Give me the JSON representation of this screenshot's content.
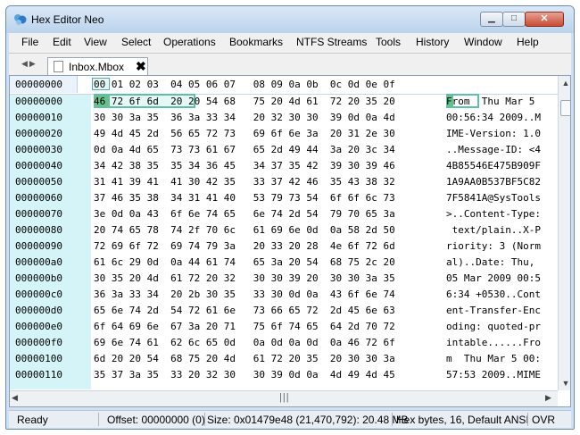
{
  "window": {
    "title": "Hex Editor Neo",
    "controls": {
      "minimize": "▁",
      "maximize": "□",
      "close": "✕"
    }
  },
  "menu": [
    "File",
    "Edit",
    "View",
    "Select",
    "Operations",
    "Bookmarks",
    "NTFS Streams",
    "Tools",
    "History",
    "Window",
    "Help"
  ],
  "tab": {
    "label": "Inbox.Mbox",
    "close": "✖"
  },
  "hex_header": {
    "offset_label": "00000000",
    "columns": "00 01 02 03  04 05 06 07   08 09 0a 0b  0c 0d 0e 0f"
  },
  "rows": [
    {
      "off": "00000000",
      "hex": "46 72 6f 6d  20 20 54 68   75 20 4d 61  72 20 35 20",
      "text": "From  Thu Mar 5 "
    },
    {
      "off": "00000010",
      "hex": "30 30 3a 35  36 3a 33 34   20 32 30 30  39 0d 0a 4d",
      "text": "00:56:34 2009..M"
    },
    {
      "off": "00000020",
      "hex": "49 4d 45 2d  56 65 72 73   69 6f 6e 3a  20 31 2e 30",
      "text": "IME-Version: 1.0"
    },
    {
      "off": "00000030",
      "hex": "0d 0a 4d 65  73 73 61 67   65 2d 49 44  3a 20 3c 34",
      "text": "..Message-ID: <4"
    },
    {
      "off": "00000040",
      "hex": "34 42 38 35  35 34 36 45   34 37 35 42  39 30 39 46",
      "text": "4B85546E475B909F"
    },
    {
      "off": "00000050",
      "hex": "31 41 39 41  41 30 42 35   33 37 42 46  35 43 38 32",
      "text": "1A9AA0B537BF5C82"
    },
    {
      "off": "00000060",
      "hex": "37 46 35 38  34 31 41 40   53 79 73 54  6f 6f 6c 73",
      "text": "7F5841A@SysTools"
    },
    {
      "off": "00000070",
      "hex": "3e 0d 0a 43  6f 6e 74 65   6e 74 2d 54  79 70 65 3a",
      "text": ">..Content-Type:"
    },
    {
      "off": "00000080",
      "hex": "20 74 65 78  74 2f 70 6c   61 69 6e 0d  0a 58 2d 50",
      "text": " text/plain..X-P"
    },
    {
      "off": "00000090",
      "hex": "72 69 6f 72  69 74 79 3a   20 33 20 28  4e 6f 72 6d",
      "text": "riority: 3 (Norm"
    },
    {
      "off": "000000a0",
      "hex": "61 6c 29 0d  0a 44 61 74   65 3a 20 54  68 75 2c 20",
      "text": "al)..Date: Thu, "
    },
    {
      "off": "000000b0",
      "hex": "30 35 20 4d  61 72 20 32   30 30 39 20  30 30 3a 35",
      "text": "05 Mar 2009 00:5"
    },
    {
      "off": "000000c0",
      "hex": "36 3a 33 34  20 2b 30 35   33 30 0d 0a  43 6f 6e 74",
      "text": "6:34 +0530..Cont"
    },
    {
      "off": "000000d0",
      "hex": "65 6e 74 2d  54 72 61 6e   73 66 65 72  2d 45 6e 63",
      "text": "ent-Transfer-Enc"
    },
    {
      "off": "000000e0",
      "hex": "6f 64 69 6e  67 3a 20 71   75 6f 74 65  64 2d 70 72",
      "text": "oding: quoted-pr"
    },
    {
      "off": "000000f0",
      "hex": "69 6e 74 61  62 6c 65 0d   0a 0d 0a 0d  0a 46 72 6f",
      "text": "intable......Fro"
    },
    {
      "off": "00000100",
      "hex": "6d 20 20 54  68 75 20 4d   61 72 20 35  20 30 30 3a",
      "text": "m  Thu Mar 5 00:"
    },
    {
      "off": "00000110",
      "hex": "35 37 3a 35  33 20 32 30   30 39 0d 0a  4d 49 4d 45",
      "text": "57:53 2009..MIME"
    }
  ],
  "status": {
    "state": "Ready",
    "offset": "Offset: 00000000 (0)",
    "size": "Size: 0x01479e48 (21,470,792): 20.48 MB",
    "mode": "Hex bytes, 16, Default ANSI",
    "ovr": "OVR"
  }
}
